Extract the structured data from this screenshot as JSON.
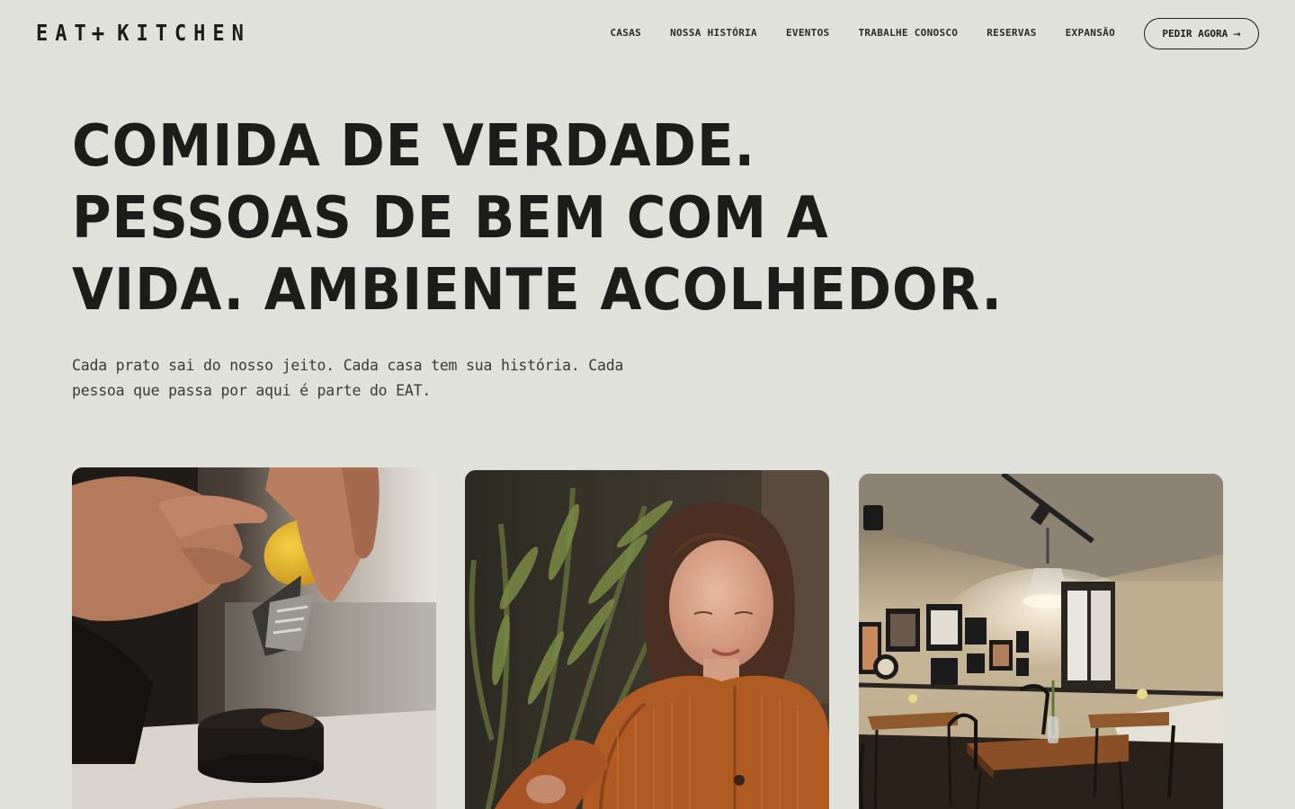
{
  "header": {
    "logo": {
      "left": "EAT",
      "plus": "+",
      "right": "KITCHEN"
    },
    "nav": [
      {
        "label": "CASAS"
      },
      {
        "label": "NOSSA HISTÓRIA"
      },
      {
        "label": "EVENTOS"
      },
      {
        "label": "TRABALHE CONOSCO"
      },
      {
        "label": "RESERVAS"
      },
      {
        "label": "EXPANSÃO"
      }
    ],
    "cta": {
      "label": "PEDIR AGORA",
      "icon": "→"
    }
  },
  "hero": {
    "title_lines": [
      "COMIDA DE VERDADE.",
      "PESSOAS DE BEM COM A",
      "VIDA. AMBIENTE ACOLHEDOR."
    ],
    "subtitle": "Cada prato sai do nosso jeito. Cada casa tem sua história. Cada pessoa que passa por aqui é parte do EAT."
  },
  "colors": {
    "background": "#e1e1dc",
    "text": "#1c1c1a"
  }
}
